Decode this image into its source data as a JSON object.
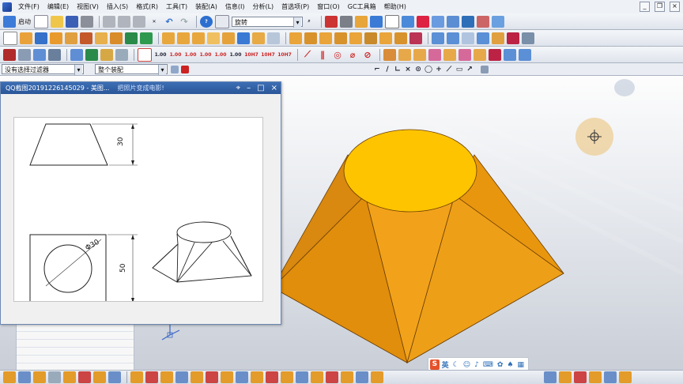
{
  "menubar": {
    "items": [
      "文件(F)",
      "编辑(E)",
      "视图(V)",
      "插入(S)",
      "格式(R)",
      "工具(T)",
      "装配(A)",
      "信息(I)",
      "分析(L)",
      "首选项(P)",
      "窗口(O)",
      "GC工具箱",
      "帮助(H)"
    ]
  },
  "toolbar1": {
    "start_label": "启动",
    "command_combo": "旋转"
  },
  "toolbar2": {},
  "toolbar3": {
    "tol_labels": [
      "1.00",
      "1.00",
      "1.00",
      "1.00",
      "1.00",
      "1.00",
      "10H7",
      "10H7",
      "10H7"
    ]
  },
  "filterbar": {
    "filter_combo": "没有选择过滤器",
    "scope_combo": "整个装配"
  },
  "qq_window": {
    "title": "QQ截图20191226145029 - 美图...",
    "tab": "把照片变成电影!",
    "drawing": {
      "dim_height_top": "30",
      "dim_diameter": "Φ30",
      "dim_height_side": "50"
    }
  },
  "ime": {
    "lang": "英",
    "icons": [
      "moon-icon",
      "smile-icon",
      "mic-icon",
      "keyboard-icon",
      "skin-icon",
      "shirt-icon",
      "grid-icon"
    ]
  },
  "colors": {
    "model_side": "#f0a020",
    "model_top": "#ffc400",
    "title_bar": "#2f5ea3",
    "viewport_top": "#fdfdfd",
    "viewport_bottom": "#c9ced7"
  }
}
